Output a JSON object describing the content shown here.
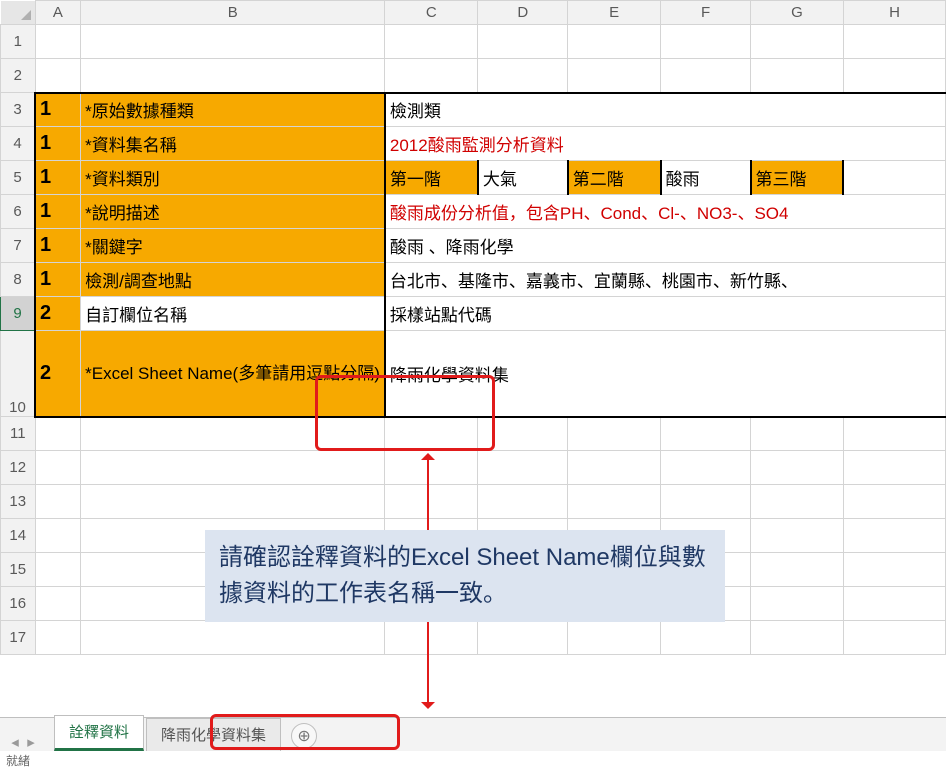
{
  "columns": [
    "A",
    "B",
    "C",
    "D",
    "E",
    "F",
    "G",
    "H"
  ],
  "rows_shown": 17,
  "selected_row": 9,
  "cells": {
    "A3": "1",
    "B3": "*原始數據種類",
    "C3": "檢測類",
    "A4": "1",
    "B4": "*資料集名稱",
    "C4": "2012酸雨監測分析資料",
    "A5": "1",
    "B5": "*資料類別",
    "C5": "第一階",
    "D5": "大氣",
    "E5": "第二階",
    "F5": "酸雨",
    "G5": "第三階",
    "A6": "1",
    "B6": "*說明描述",
    "C6": "酸雨成份分析值，包含PH、Cond、Cl-、NO3-、SO4",
    "A7": "1",
    "B7": "*關鍵字",
    "C7": "酸雨 、降雨化學",
    "A8": "1",
    "B8": "檢測/調查地點",
    "C8": "台北市、基隆市、嘉義市、宜蘭縣、桃園市、新竹縣、",
    "A9": "2",
    "B9": "自訂欄位名稱",
    "C9": "採樣站點代碼",
    "A10": "2",
    "B10": "*Excel Sheet Name(多筆請用逗點分隔)",
    "C10": "降雨化學資料集"
  },
  "annotation": {
    "text": "請確認詮釋資料的Excel Sheet Name欄位與數據資料的工作表名稱一致。"
  },
  "tabs": {
    "items": [
      {
        "label": "詮釋資料",
        "active": true
      },
      {
        "label": "降雨化學資料集",
        "active": false
      }
    ],
    "add_icon": "⊕"
  },
  "status_left": "就緒"
}
